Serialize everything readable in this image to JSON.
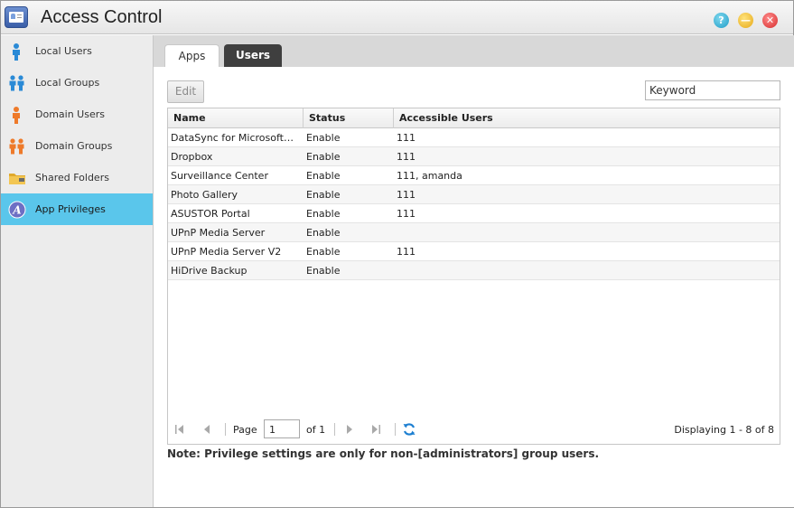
{
  "window": {
    "title": "Access Control"
  },
  "title_buttons": {
    "help": "?",
    "minimize": "—",
    "close": "✕"
  },
  "sidebar": {
    "items": [
      {
        "label": "Local Users",
        "icon": "user-icon"
      },
      {
        "label": "Local Groups",
        "icon": "group-icon"
      },
      {
        "label": "Domain Users",
        "icon": "domain-user-icon"
      },
      {
        "label": "Domain Groups",
        "icon": "domain-group-icon"
      },
      {
        "label": "Shared Folders",
        "icon": "folder-icon"
      },
      {
        "label": "App Privileges",
        "icon": "app-privileges-icon",
        "active": true
      }
    ]
  },
  "tabs": [
    {
      "label": "Apps",
      "active": true
    },
    {
      "label": "Users",
      "active": false
    }
  ],
  "toolbar": {
    "edit_label": "Edit",
    "search_placeholder": "Keyword"
  },
  "table": {
    "columns": [
      "Name",
      "Status",
      "Accessible Users"
    ],
    "rows": [
      {
        "name": "DataSync for Microsoft…",
        "status": "Enable",
        "users": "111"
      },
      {
        "name": "Dropbox",
        "status": "Enable",
        "users": "111"
      },
      {
        "name": "Surveillance Center",
        "status": "Enable",
        "users": "111, amanda"
      },
      {
        "name": "Photo Gallery",
        "status": "Enable",
        "users": "111"
      },
      {
        "name": "ASUSTOR Portal",
        "status": "Enable",
        "users": "111"
      },
      {
        "name": "UPnP Media Server",
        "status": "Enable",
        "users": ""
      },
      {
        "name": "UPnP Media Server V2",
        "status": "Enable",
        "users": "111"
      },
      {
        "name": "HiDrive Backup",
        "status": "Enable",
        "users": ""
      }
    ]
  },
  "pager": {
    "page_label": "Page",
    "page_value": "1",
    "of_label": "of 1",
    "display_text": "Displaying 1 - 8 of 8"
  },
  "note": "Note: Privilege settings are only for non-[administrators] group users.",
  "colors": {
    "accent": "#5ac6eb",
    "tab_dark": "#3f3f3f"
  }
}
